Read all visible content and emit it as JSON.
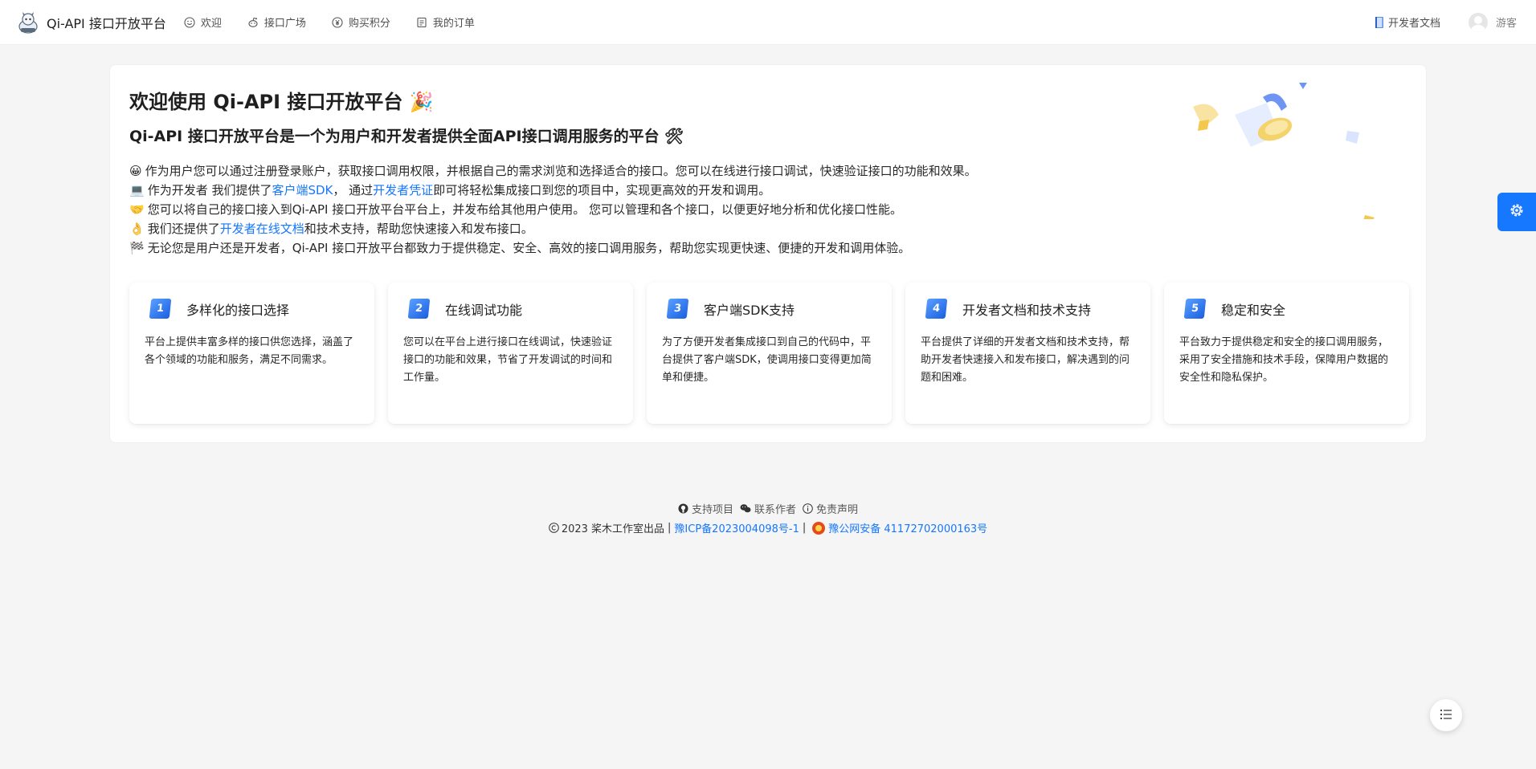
{
  "header": {
    "logo_title": "Qi-API 接口开放平台",
    "nav": [
      {
        "label": "欢迎",
        "icon": "smile-icon"
      },
      {
        "label": "接口广场",
        "icon": "reddit-icon"
      },
      {
        "label": "购买积分",
        "icon": "yuan-icon"
      },
      {
        "label": "我的订单",
        "icon": "order-icon"
      }
    ],
    "doc_link": "开发者文档",
    "user_name": "游客"
  },
  "main": {
    "title": "欢迎使用 Qi-API 接口开放平台 🎉",
    "subtitle": "Qi-API 接口开放平台是一个为用户和开发者提供全面API接口调用服务的平台 🛠",
    "paragraphs": [
      {
        "emoji": "😀",
        "text": "作为用户您可以通过注册登录账户，获取接口调用权限，并根据自己的需求浏览和选择适合的接口。您可以在线进行接口调试，快速验证接口的功能和效果。"
      },
      {
        "emoji": "💻",
        "pre": "作为开发者 我们提供了",
        "link1": "客户端SDK",
        "mid": "， 通过",
        "link2": "开发者凭证",
        "post": "即可将轻松集成接口到您的项目中，实现更高效的开发和调用。"
      },
      {
        "emoji": "🤝",
        "text": "您可以将自己的接口接入到Qi-API 接口开放平台平台上，并发布给其他用户使用。 您可以管理和各个接口，以便更好地分析和优化接口性能。"
      },
      {
        "emoji": "👌",
        "pre": "我们还提供了",
        "link1": "开发者在线文档",
        "post": "和技术支持，帮助您快速接入和发布接口。"
      },
      {
        "emoji": "🏁",
        "text": "无论您是用户还是开发者，Qi-API 接口开放平台都致力于提供稳定、安全、高效的接口调用服务，帮助您实现更快速、便捷的开发和调用体验。"
      }
    ],
    "features": [
      {
        "num": "1",
        "title": "多样化的接口选择",
        "desc": "平台上提供丰富多样的接口供您选择，涵盖了各个领域的功能和服务，满足不同需求。"
      },
      {
        "num": "2",
        "title": "在线调试功能",
        "desc": "您可以在平台上进行接口在线调试，快速验证接口的功能和效果，节省了开发调试的时间和工作量。"
      },
      {
        "num": "3",
        "title": "客户端SDK支持",
        "desc": "为了方便开发者集成接口到自己的代码中，平台提供了客户端SDK，使调用接口变得更加简单和便捷。"
      },
      {
        "num": "4",
        "title": "开发者文档和技术支持",
        "desc": "平台提供了详细的开发者文档和技术支持，帮助开发者快速接入和发布接口，解决遇到的问题和困难。"
      },
      {
        "num": "5",
        "title": "稳定和安全",
        "desc": "平台致力于提供稳定和安全的接口调用服务，采用了安全措施和技术手段，保障用户数据的安全性和隐私保护。"
      }
    ]
  },
  "footer": {
    "links": [
      "支持项目",
      "联系作者",
      "免责声明"
    ],
    "copyright": "2023 桨木工作室出品",
    "icp": "豫ICP备2023004098号-1",
    "police": "豫公网安备 41172702000163号"
  },
  "colors": {
    "accent": "#1677ff",
    "background": "#f5f5f5"
  }
}
